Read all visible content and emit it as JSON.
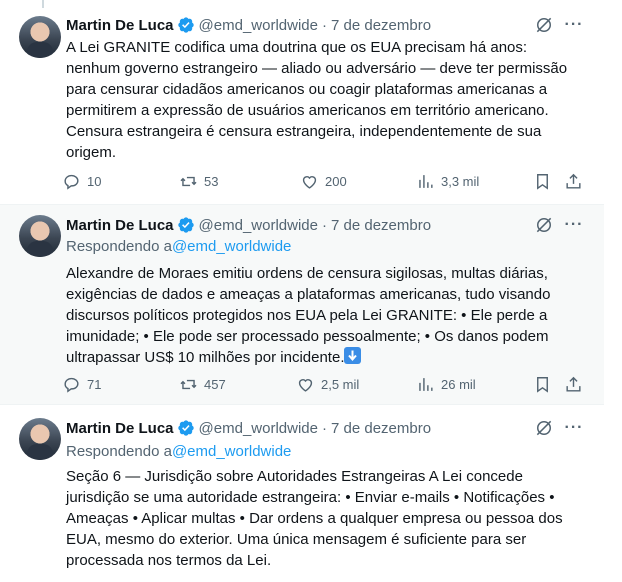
{
  "tweets": [
    {
      "author_name": "Martin De Luca",
      "handle": "@emd_worldwide",
      "separator": "·",
      "date": "7 de dezembro",
      "replying_prefix": "",
      "replying_to": "",
      "text": "A Lei GRANITE codifica uma doutrina que os EUA precisam há anos:\nnenhum governo estrangeiro — aliado ou adversário — deve ter permissão\npara censurar cidadãos americanos ou coagir plataformas americanas a\npermitirem a expressão de usuários americanos em território americano.\nCensura estrangeira é censura estrangeira, independentemente de sua\norigem.",
      "replies": "10",
      "reposts": "53",
      "likes": "200",
      "views": "3,3 mil"
    },
    {
      "author_name": "Martin De Luca",
      "handle": "@emd_worldwide",
      "separator": "·",
      "date": "7 de dezembro",
      "replying_prefix": "Respondendo a",
      "replying_to": "@emd_worldwide",
      "text": "Alexandre de Moraes emitiu ordens de censura sigilosas, multas diárias,\nexigências de dados e ameaças a plataformas americanas, tudo visando\ndiscursos políticos protegidos nos EUA pela Lei GRANITE: • Ele perde a\nimunidade; • Ele pode ser processado pessoalmente; • Os danos podem\nultrapassar US$ 10 milhões por incidente.",
      "replies": "71",
      "reposts": "457",
      "likes": "2,5 mil",
      "views": "26 mil"
    },
    {
      "author_name": "Martin De Luca",
      "handle": "@emd_worldwide",
      "separator": "·",
      "date": "7 de dezembro",
      "replying_prefix": "Respondendo a",
      "replying_to": "@emd_worldwide",
      "text": "Seção 6 — Jurisdição sobre Autoridades Estrangeiras A Lei concede\njurisdição se uma autoridade estrangeira: • Enviar e-mails • Notificações •\nAmeaças • Aplicar multas • Dar ordens a qualquer empresa ou pessoa dos\nEUA, mesmo do exterior. Uma única mensagem é suficiente para ser\nprocessada nos termos da Lei.",
      "replies": "",
      "reposts": "",
      "likes": "",
      "views": ""
    }
  ],
  "icons": {
    "verified": "verified-badge-icon",
    "grok": "grok-icon",
    "more": "more-icon",
    "reply": "reply-icon",
    "repost": "repost-icon",
    "like": "like-icon",
    "views": "views-icon",
    "bookmark": "bookmark-icon",
    "share": "share-icon"
  },
  "colors": {
    "accent": "#1d9bf0",
    "secondary_text": "#536471",
    "highlight_bg": "#f7f9f9"
  }
}
